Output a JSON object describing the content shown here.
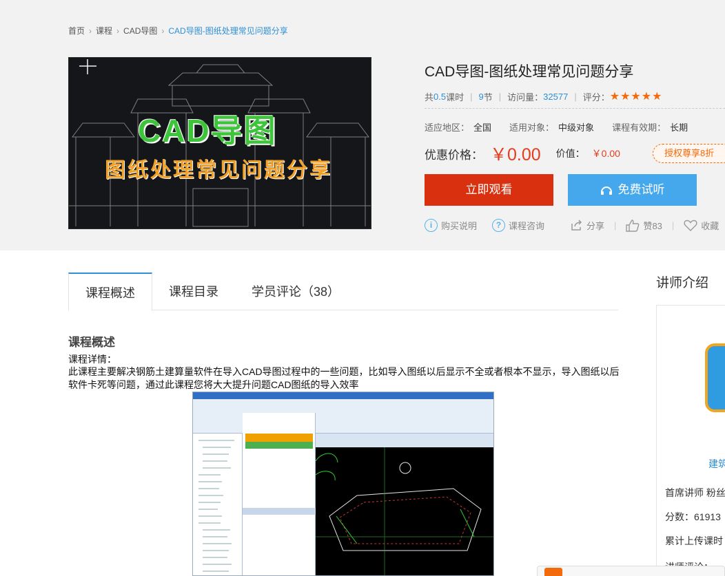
{
  "breadcrumb": [
    "首页",
    "课程",
    "CAD导图",
    "CAD导图-图纸处理常见问题分享"
  ],
  "cover": {
    "title": "CAD导图",
    "subtitle": "图纸处理常见问题分享"
  },
  "course": {
    "title": "CAD导图-图纸处理常见问题分享",
    "hours_prefix": "共",
    "hours": "0.5",
    "hours_suffix": "课时",
    "sections_num": "9",
    "sections_unit": "节",
    "visits_label": "访问量：",
    "visits": "32577",
    "rating_label": "评分：",
    "rating": 5,
    "stars": "★★★★★",
    "region_label": "适应地区：",
    "region": "全国",
    "audience_label": "适用对象：",
    "audience": "中级对象",
    "validity_label": "课程有效期：",
    "validity": "长期",
    "price_label": "优惠价格：",
    "price": "￥0.00",
    "value_label": "价值：",
    "value": "￥0.00",
    "coupon": "授权尊享8折"
  },
  "buttons": {
    "watch": "立即观看",
    "trial": "免费试听"
  },
  "actions": {
    "buy_info": "购买说明",
    "consult": "课程咨询",
    "share": "分享",
    "like": "赞83",
    "favorite": "收藏"
  },
  "tabs": [
    "课程概述",
    "课程目录",
    "学员评论（38）"
  ],
  "overview": {
    "title": "课程概述",
    "subtitle": "课程详情：",
    "text": "此课程主要解决钢筋土建算量软件在导入CAD导图过程中的一些问题，比如导入图纸以后显示不全或者根本不显示，导入图纸以后软件卡死等问题，通过此课程您将大大提升问题CAD图纸的导入效率"
  },
  "teacher": {
    "heading": "讲师介绍",
    "name": "建筑",
    "title_line": "首席讲师 粉丝",
    "score_line": "分数：61913",
    "upload_line": "累计上传课时",
    "comment_line": "讲师评论："
  },
  "colors": {
    "accent": "#2d8fd5",
    "price": "#e43c1c",
    "watch_btn": "#d9310f",
    "trial_btn": "#46a8ec",
    "star": "#f36a0c"
  }
}
